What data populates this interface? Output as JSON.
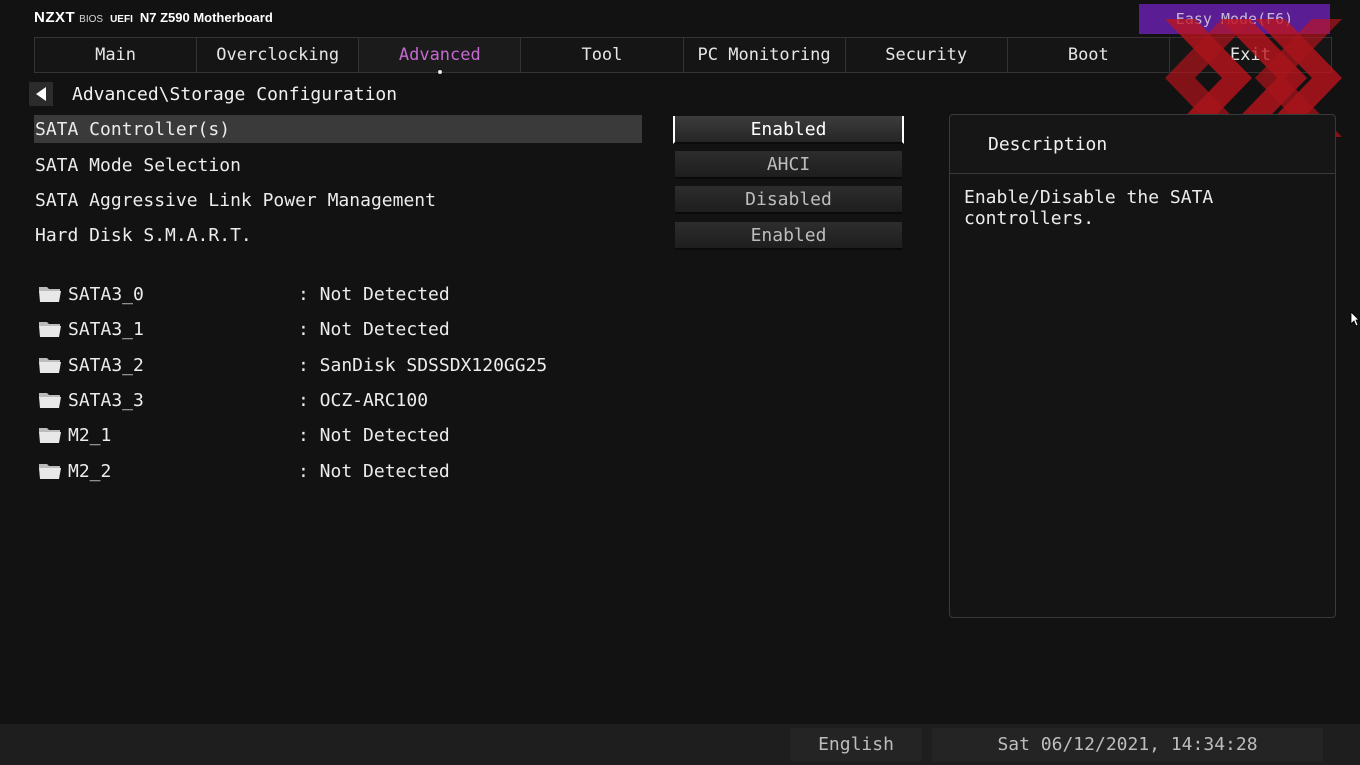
{
  "header": {
    "logo": "NZXT",
    "bios": "BIOS",
    "uefi": "UEFI",
    "model": "N7 Z590 Motherboard",
    "easy_mode": "Easy Mode(F6)"
  },
  "tabs": [
    {
      "label": "Main"
    },
    {
      "label": "Overclocking"
    },
    {
      "label": "Advanced",
      "active": true
    },
    {
      "label": "Tool"
    },
    {
      "label": "PC Monitoring"
    },
    {
      "label": "Security"
    },
    {
      "label": "Boot"
    },
    {
      "label": "Exit"
    }
  ],
  "breadcrumb": "Advanced\\Storage Configuration",
  "settings": [
    {
      "label": "SATA Controller(s)",
      "value": "Enabled",
      "selected": true
    },
    {
      "label": "SATA Mode Selection",
      "value": "AHCI"
    },
    {
      "label": "SATA Aggressive Link Power Management",
      "value": "Disabled"
    },
    {
      "label": "Hard Disk S.M.A.R.T.",
      "value": "Enabled"
    }
  ],
  "devices": [
    {
      "port": "SATA3_0",
      "value": ": Not Detected"
    },
    {
      "port": "SATA3_1",
      "value": ": Not Detected"
    },
    {
      "port": "SATA3_2",
      "value": ": SanDisk SDSSDX120GG25"
    },
    {
      "port": "SATA3_3",
      "value": ": OCZ-ARC100"
    },
    {
      "port": "M2_1",
      "value": ": Not Detected"
    },
    {
      "port": "M2_2",
      "value": ": Not Detected"
    }
  ],
  "description": {
    "title": "Description",
    "text": "Enable/Disable the SATA controllers."
  },
  "footer": {
    "language": "English",
    "datetime": "Sat 06/12/2021, 14:34:28"
  },
  "colors": {
    "accent_purple": "#c66ad1",
    "easy_mode_bg": "#5b1d93",
    "watermark_red": "#c0141c"
  },
  "icons": [
    "folder-icon",
    "back-arrow-icon",
    "mouse-cursor-icon",
    "xx-watermark-logo"
  ]
}
